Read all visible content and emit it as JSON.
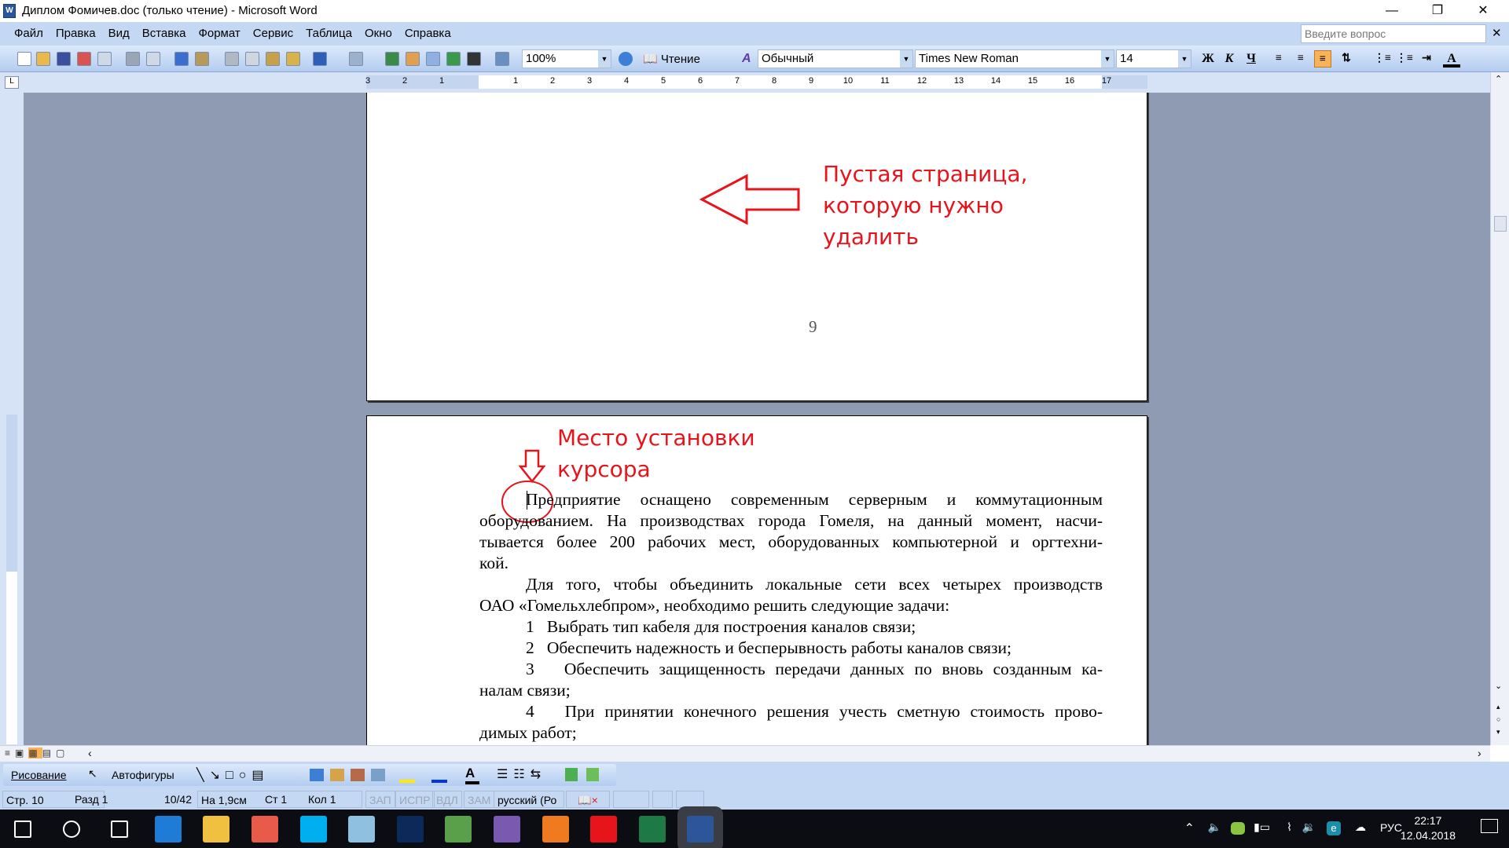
{
  "window": {
    "title": "Диплом Фомичев.doc (только чтение) - Microsoft Word"
  },
  "menu": {
    "items": [
      "Файл",
      "Правка",
      "Вид",
      "Вставка",
      "Формат",
      "Сервис",
      "Таблица",
      "Окно",
      "Справка"
    ],
    "ask_placeholder": "Введите вопрос"
  },
  "toolbar": {
    "zoom": "100%",
    "reading_label": "Чтение",
    "style": "Обычный",
    "font": "Times New Roman",
    "size": "14",
    "bold": "Ж",
    "italic": "К",
    "underline": "Ч",
    "accent_active": "#f8b35a"
  },
  "ruler": {
    "left_numbers": [
      "3",
      "2",
      "1"
    ],
    "right_numbers": [
      "1",
      "2",
      "3",
      "4",
      "5",
      "6",
      "7",
      "8",
      "9",
      "10",
      "11",
      "12",
      "13",
      "14",
      "15",
      "16",
      "17"
    ]
  },
  "page1": {
    "page_number": "9",
    "annotation": [
      "Пустая страница,",
      "которую нужно",
      "удалить"
    ]
  },
  "page2": {
    "annotation": [
      "Место установки",
      "курсора"
    ],
    "lines": [
      {
        "t": "Предприятие оснащено современным серверным и коммутационным",
        "ind": true,
        "last": false
      },
      {
        "t": "оборудованием. На производствах города Гомеля, на данный момент, насчи-",
        "ind": false,
        "last": false
      },
      {
        "t": "тывается более 200 рабочих мест, оборудованных компьютерной и оргтехни-",
        "ind": false,
        "last": false
      },
      {
        "t": "кой.",
        "ind": false,
        "last": true
      },
      {
        "t": "Для того, чтобы объединить локальные сети всех четырех производств",
        "ind": true,
        "last": false
      },
      {
        "t": "ОАО «Гомельхлебпром», необходимо решить следующие задачи:",
        "ind": false,
        "last": true
      },
      {
        "t": "1   Выбрать тип кабеля для построения каналов связи;",
        "ind": true,
        "last": true
      },
      {
        "t": "2   Обеспечить надежность и бесперывность работы каналов связи;",
        "ind": true,
        "last": true
      },
      {
        "t": "3   Обеспечить защищенность передачи данных по вновь созданным ка-",
        "ind": true,
        "last": false
      },
      {
        "t": "налам связи;",
        "ind": false,
        "last": true
      },
      {
        "t": "4   При принятии конечного решения учесть сметную стоимость прово-",
        "ind": true,
        "last": false
      },
      {
        "t": "димых работ;",
        "ind": false,
        "last": true
      }
    ]
  },
  "annotation_color": "#e8141c",
  "drawing": {
    "draw_label": "Рисование",
    "autoshapes_label": "Автофигуры"
  },
  "status": {
    "page": "Стр. 10",
    "section": "Разд 1",
    "pages": "10/42",
    "at": "На 1,9см",
    "line": "Ст 1",
    "col": "Кол 1",
    "rec": "ЗАП",
    "trk": "ИСПР",
    "ext": "ВДЛ",
    "ovr": "ЗАМ",
    "lang": "русский (Ро"
  },
  "taskbar": {
    "apps": [
      "start",
      "search",
      "task-view",
      "edge",
      "explorer",
      "paint",
      "skype",
      "app",
      "photoshop",
      "app2",
      "save",
      "firefox",
      "yandex",
      "excel",
      "word"
    ],
    "lang": "РУС",
    "time": "22:17",
    "date": "12.04.2018"
  }
}
